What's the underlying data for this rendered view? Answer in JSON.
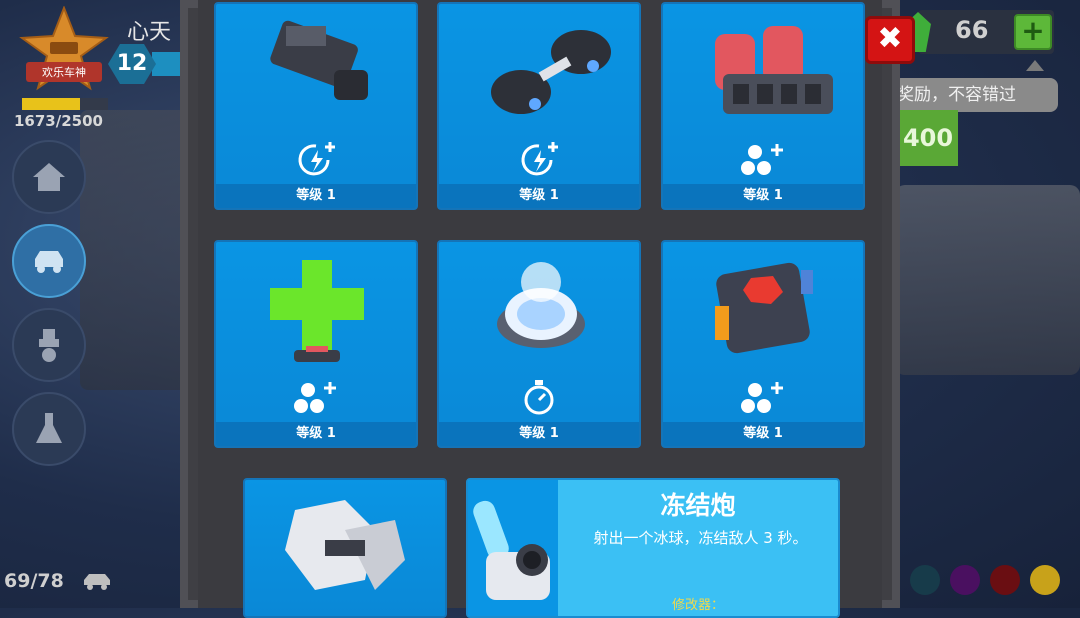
{
  "hud": {
    "rank_label": "欢乐车神",
    "player_name": "心天",
    "level": "12",
    "xp_text": "1673/2500",
    "xp_fraction": 0.669,
    "car_count": "69/78",
    "gems": "66",
    "plus_symbol": "+",
    "tooltip": "奖励，不容错过",
    "price": "400",
    "nav_icons": [
      "home-icon",
      "car-icon",
      "weapon-icon",
      "flask-icon"
    ]
  },
  "modal": {
    "close_symbol": "✖",
    "cards": [
      {
        "art": "cannon-part-icon",
        "stat": "energy-plus-icon",
        "level": "等级 1"
      },
      {
        "art": "twin-thruster-icon",
        "stat": "energy-plus-icon",
        "level": "等级 1"
      },
      {
        "art": "rocket-pod-icon",
        "stat": "balls-plus-icon",
        "level": "等级 1"
      },
      {
        "art": "green-cross-icon",
        "stat": "balls-plus-icon",
        "level": "等级 1"
      },
      {
        "art": "shield-dome-icon",
        "stat": "stopwatch-icon",
        "level": "等级 1"
      },
      {
        "art": "red-core-icon",
        "stat": "balls-plus-icon",
        "level": "等级 1"
      }
    ],
    "detail": {
      "title": "冻结炮",
      "description": "射出一个冰球，冻结敌人 3 秒。",
      "sub": "修改器："
    }
  },
  "colors": {
    "card_blue": "#0a95e4",
    "close_red": "#d41414",
    "gem_green": "#3fae3a",
    "swatches": [
      "#173b4a",
      "#4a1060",
      "#6a0e12",
      "#c8a21a"
    ]
  }
}
